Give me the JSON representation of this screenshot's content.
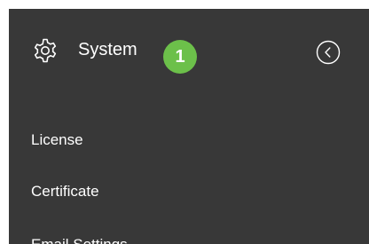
{
  "header": {
    "title": "System",
    "badge": "1",
    "icon": "gear-icon",
    "collapse_icon": "chevron-left-circle-icon"
  },
  "menu": {
    "items": [
      {
        "label": "License"
      },
      {
        "label": "Certificate"
      },
      {
        "label": "Email Settings"
      }
    ]
  },
  "colors": {
    "panel_bg": "#383838",
    "text": "#ffffff",
    "badge_bg": "#6cc04a"
  }
}
